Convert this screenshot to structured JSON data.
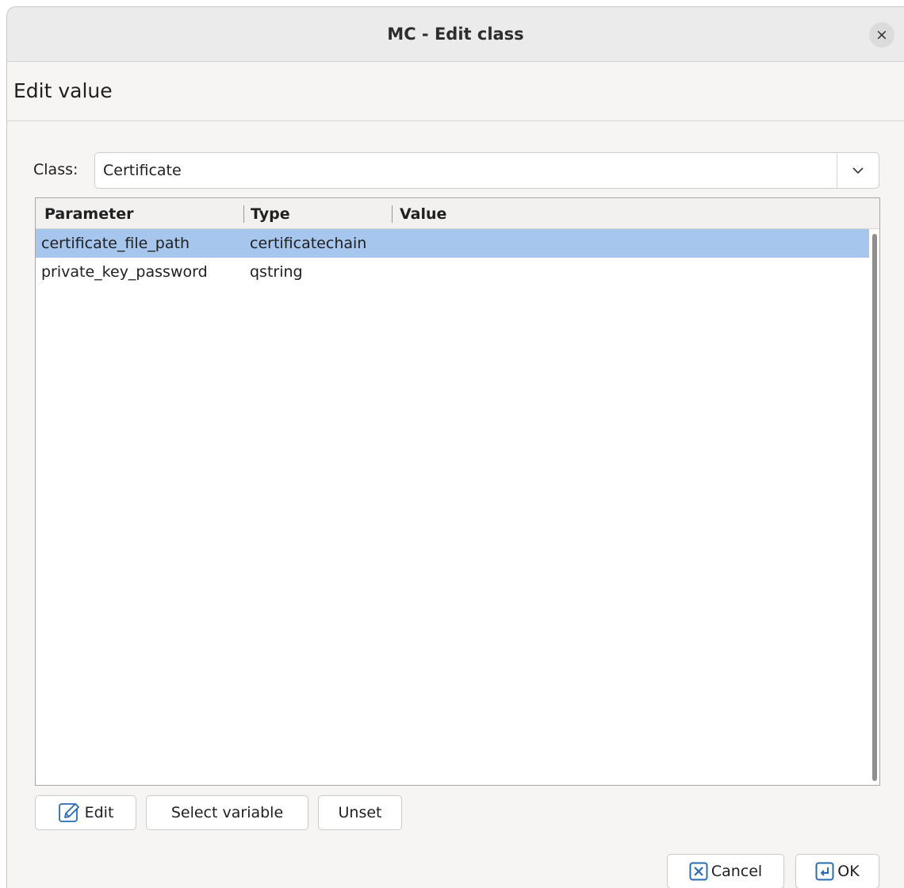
{
  "window": {
    "title": "MC - Edit class",
    "close_glyph": "×"
  },
  "section": {
    "title": "Edit value"
  },
  "class_selector": {
    "label": "Class:",
    "value": "Certificate"
  },
  "table": {
    "columns": [
      "Parameter",
      "Type",
      "Value"
    ],
    "rows": [
      {
        "parameter": "certificate_file_path",
        "type": "certificatechain",
        "value": "",
        "selected": true
      },
      {
        "parameter": "private_key_password",
        "type": "qstring",
        "value": "",
        "selected": false
      }
    ]
  },
  "actions": {
    "edit_label": "Edit",
    "select_variable_label": "Select variable",
    "unset_label": "Unset"
  },
  "dialog_buttons": {
    "cancel_label": "Cancel",
    "ok_label": "OK"
  },
  "colors": {
    "selection": "#a7c6ed",
    "accent_icon": "#2a6bb5"
  },
  "icons": {
    "close": "close-icon",
    "dropdown": "chevron-down-icon",
    "edit": "pencil-icon",
    "cancel": "cancel-x-icon",
    "ok": "enter-return-icon"
  }
}
